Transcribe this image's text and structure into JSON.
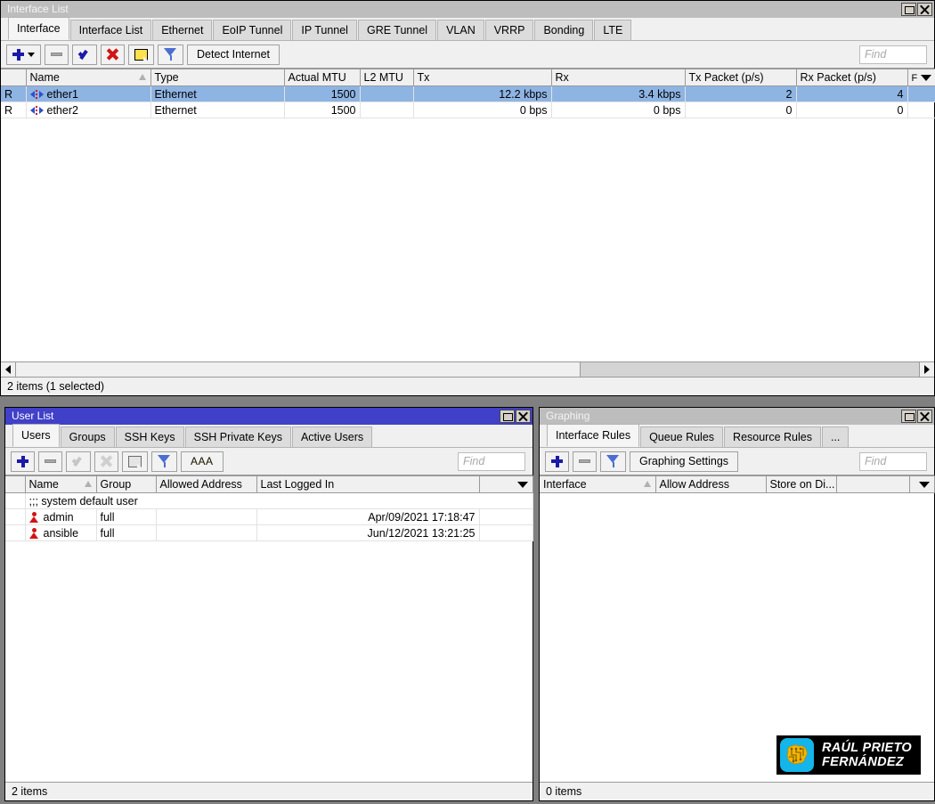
{
  "interface_window": {
    "title": "Interface List",
    "titlebar_color": "#bdbdbd",
    "controls": {
      "maximize": "maximize-button",
      "close": "close-button"
    },
    "tabs": [
      {
        "label": "Interface",
        "selected": true
      },
      {
        "label": "Interface List",
        "selected": false
      },
      {
        "label": "Ethernet",
        "selected": false
      },
      {
        "label": "EoIP Tunnel",
        "selected": false
      },
      {
        "label": "IP Tunnel",
        "selected": false
      },
      {
        "label": "GRE Tunnel",
        "selected": false
      },
      {
        "label": "VLAN",
        "selected": false
      },
      {
        "label": "VRRP",
        "selected": false
      },
      {
        "label": "Bonding",
        "selected": false
      },
      {
        "label": "LTE",
        "selected": false
      }
    ],
    "toolbar": {
      "add_icon": "plus-icon",
      "remove_icon": "minus-icon",
      "enable_icon": "check-icon",
      "disable_icon": "cross-icon",
      "comment_icon": "note-icon",
      "filter_icon": "funnel-icon",
      "detect_internet_label": "Detect Internet",
      "find_placeholder": "Find"
    },
    "columns": [
      "",
      "Name",
      "Type",
      "Actual MTU",
      "L2 MTU",
      "Tx",
      "Rx",
      "Tx Packet (p/s)",
      "Rx Packet (p/s)",
      "F"
    ],
    "rows": [
      {
        "flag": "R",
        "name": "ether1",
        "type": "Ethernet",
        "actual_mtu": "1500",
        "l2_mtu": "",
        "tx": "12.2 kbps",
        "rx": "3.4 kbps",
        "tx_pps": "2",
        "rx_pps": "4",
        "selected": true
      },
      {
        "flag": "R",
        "name": "ether2",
        "type": "Ethernet",
        "actual_mtu": "1500",
        "l2_mtu": "",
        "tx": "0 bps",
        "rx": "0 bps",
        "tx_pps": "0",
        "rx_pps": "0",
        "selected": false
      }
    ],
    "status": "2 items (1 selected)"
  },
  "user_window": {
    "title": "User List",
    "titlebar_color": "#4040c8",
    "tabs": [
      {
        "label": "Users",
        "selected": true
      },
      {
        "label": "Groups",
        "selected": false
      },
      {
        "label": "SSH Keys",
        "selected": false
      },
      {
        "label": "SSH Private Keys",
        "selected": false
      },
      {
        "label": "Active Users",
        "selected": false
      }
    ],
    "toolbar": {
      "add_icon": "plus-icon",
      "remove_icon": "minus-icon",
      "enable_icon": "check-icon-disabled",
      "disable_icon": "cross-icon-disabled",
      "comment_icon": "note-icon",
      "filter_icon": "funnel-icon",
      "aaa_label": "AAA",
      "find_placeholder": "Find"
    },
    "columns": [
      "",
      "Name",
      "Group",
      "Allowed Address",
      "Last Logged In",
      ""
    ],
    "comment_row": ";;; system default user",
    "rows": [
      {
        "name": "admin",
        "group": "full",
        "allowed_address": "",
        "last_logged_in": "Apr/09/2021 17:18:47"
      },
      {
        "name": "ansible",
        "group": "full",
        "allowed_address": "",
        "last_logged_in": "Jun/12/2021 13:21:25"
      }
    ],
    "status": "2 items"
  },
  "graphing_window": {
    "title": "Graphing",
    "titlebar_color": "#bdbdbd",
    "tabs": [
      {
        "label": "Interface Rules",
        "selected": true
      },
      {
        "label": "Queue Rules",
        "selected": false
      },
      {
        "label": "Resource Rules",
        "selected": false
      },
      {
        "label": "...",
        "selected": false
      }
    ],
    "toolbar": {
      "add_icon": "plus-icon",
      "remove_icon": "minus-icon",
      "filter_icon": "funnel-icon",
      "settings_label": "Graphing Settings",
      "find_placeholder": "Find"
    },
    "columns": [
      "Interface",
      "Allow Address",
      "Store on Di...",
      ""
    ],
    "rows": [],
    "status": "0 items"
  },
  "watermark": {
    "line1": "RAÚL PRIETO",
    "line2": "FERNÁNDEZ",
    "badge_color": "#13b5ea",
    "badge_icon": "brain-circuit-icon",
    "background": "#000000"
  }
}
